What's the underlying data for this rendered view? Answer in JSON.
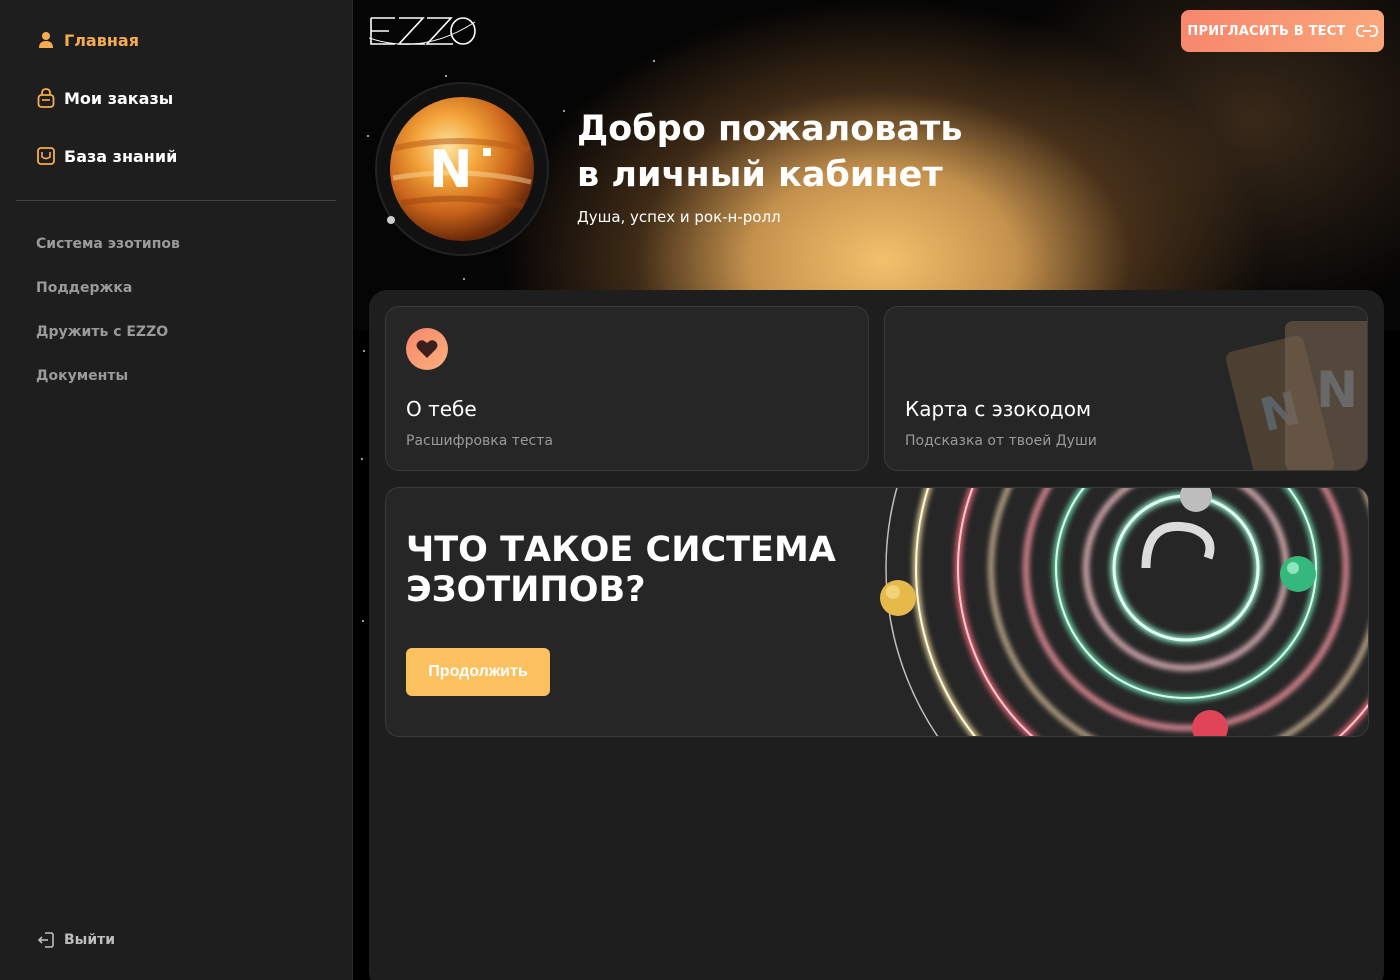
{
  "sidebar": {
    "main_items": [
      {
        "label": "Главная",
        "icon": "user-icon",
        "active": true
      },
      {
        "label": "Мои заказы",
        "icon": "bag-icon",
        "active": false
      },
      {
        "label": "База знаний",
        "icon": "book-icon",
        "active": false
      }
    ],
    "secondary_items": [
      {
        "label": "Система эзотипов"
      },
      {
        "label": "Поддержка"
      },
      {
        "label": "Дружить с EZZO"
      },
      {
        "label": "Документы"
      }
    ],
    "logout_label": "Выйти",
    "logout_icon": "logout-icon"
  },
  "header": {
    "logo_text": "EZZO",
    "invite_label": "ПРИГЛАСИТЬ В ТЕСТ",
    "invite_icon": "link-icon"
  },
  "hero": {
    "title_line1": "Добро пожаловать",
    "title_line2": "в личный кабинет",
    "subtitle": "Душа, успех и рок-н-ролл",
    "badge_letter": "N"
  },
  "cards": {
    "about": {
      "title": "О тебе",
      "subtitle": "Расшифровка теста",
      "icon": "heart-icon"
    },
    "map": {
      "title": "Карта с эзокодом",
      "subtitle": "Подсказка от твоей Души"
    },
    "system": {
      "title_line1": "ЧТО ТАКОЕ СИСТЕМА",
      "title_line2": "ЭЗОТИПОВ?",
      "button_label": "Продолжить"
    }
  },
  "colors": {
    "accent": "#f6ac4f",
    "button_yellow": "#fbc15e",
    "invite_gradient_start": "#f7876d",
    "invite_gradient_end": "#fba67a",
    "sidebar_bg": "#1e1e1e",
    "card_bg": "#262626"
  }
}
